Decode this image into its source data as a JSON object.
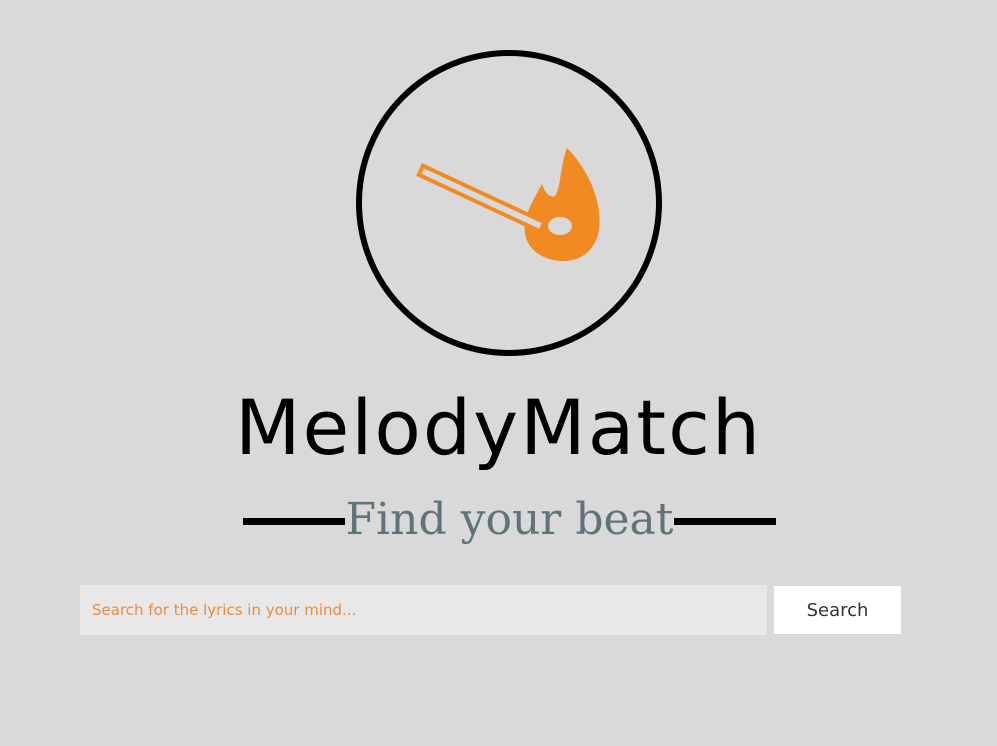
{
  "brand": {
    "name": "MelodyMatch",
    "tagline": "Find your beat",
    "logo_icon": "burning-match-icon"
  },
  "search": {
    "placeholder": "Search for the lyrics in your mind...",
    "value": "",
    "button_label": "Search"
  },
  "colors": {
    "background": "#d9d9d9",
    "accent": "#f28a24",
    "tagline": "#61737a",
    "input_background": "#e8e8e8"
  }
}
